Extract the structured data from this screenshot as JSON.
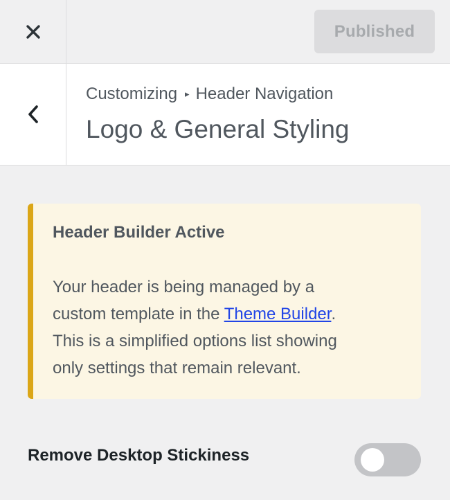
{
  "topbar": {
    "close_icon": "close-icon",
    "publish_label": "Published",
    "publish_state": "disabled"
  },
  "header": {
    "back_icon": "chevron-left-icon",
    "breadcrumb": {
      "root": "Customizing",
      "separator": "▸",
      "section": "Header Navigation"
    },
    "title": "Logo & General Styling"
  },
  "notice": {
    "title": "Header Builder Active",
    "line1": "Your header is being managed by a",
    "line2_prefix": "custom template in the ",
    "link_text": "Theme Builder",
    "line2_suffix": ".",
    "line3": "This is a simplified options list showing",
    "line4": "only settings that remain relevant.",
    "accent_color": "#dba617"
  },
  "settings": {
    "remove_desktop_stickiness": {
      "label": "Remove Desktop Stickiness",
      "enabled": false
    }
  }
}
